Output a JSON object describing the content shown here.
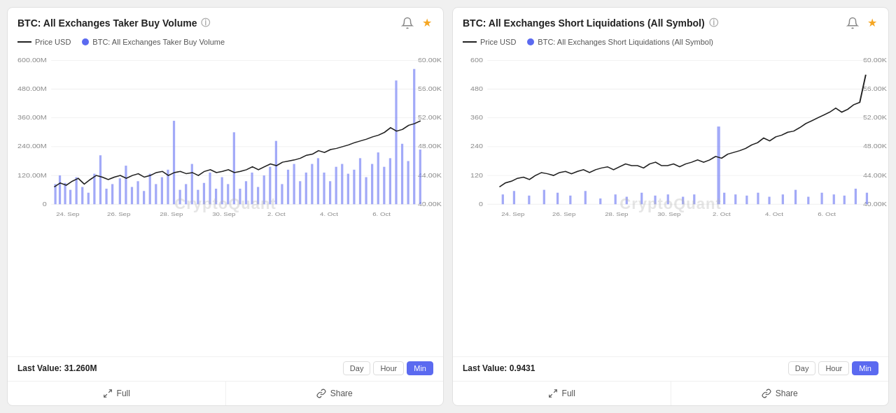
{
  "chart1": {
    "title": "BTC: All Exchanges Taker Buy Volume",
    "legend_line": "Price USD",
    "legend_dot": "BTC: All Exchanges Taker Buy Volume",
    "last_value_label": "Last Value:",
    "last_value": "31.260M",
    "watermark": "CryptoQuant",
    "time_buttons": [
      "Day",
      "Hour",
      "Min"
    ],
    "active_time": "Min",
    "x_labels": [
      "24. Sep",
      "26. Sep",
      "28. Sep",
      "30. Sep",
      "2. Oct",
      "4. Oct",
      "6. Oct"
    ],
    "y_left": [
      "600.00M",
      "480.00M",
      "360.00M",
      "240.00M",
      "120.00M",
      "0"
    ],
    "y_right": [
      "60.00K",
      "56.00K",
      "52.00K",
      "48.00K",
      "44.00K",
      "40.00K"
    ],
    "full_label": "Full",
    "share_label": "Share"
  },
  "chart2": {
    "title": "BTC: All Exchanges Short Liquidations (All Symbol)",
    "legend_line": "Price USD",
    "legend_dot": "BTC: All Exchanges Short Liquidations (All Symbol)",
    "last_value_label": "Last Value:",
    "last_value": "0.9431",
    "watermark": "CryptoQuant",
    "time_buttons": [
      "Day",
      "Hour",
      "Min"
    ],
    "active_time": "Min",
    "x_labels": [
      "24. Sep",
      "26. Sep",
      "28. Sep",
      "30. Sep",
      "2. Oct",
      "4. Oct",
      "6. Oct"
    ],
    "y_left": [
      "600",
      "480",
      "360",
      "240",
      "120",
      "0"
    ],
    "y_right": [
      "60.00K",
      "56.00K",
      "52.00K",
      "48.00K",
      "44.00K",
      "40.00K"
    ],
    "full_label": "Full",
    "share_label": "Share"
  }
}
